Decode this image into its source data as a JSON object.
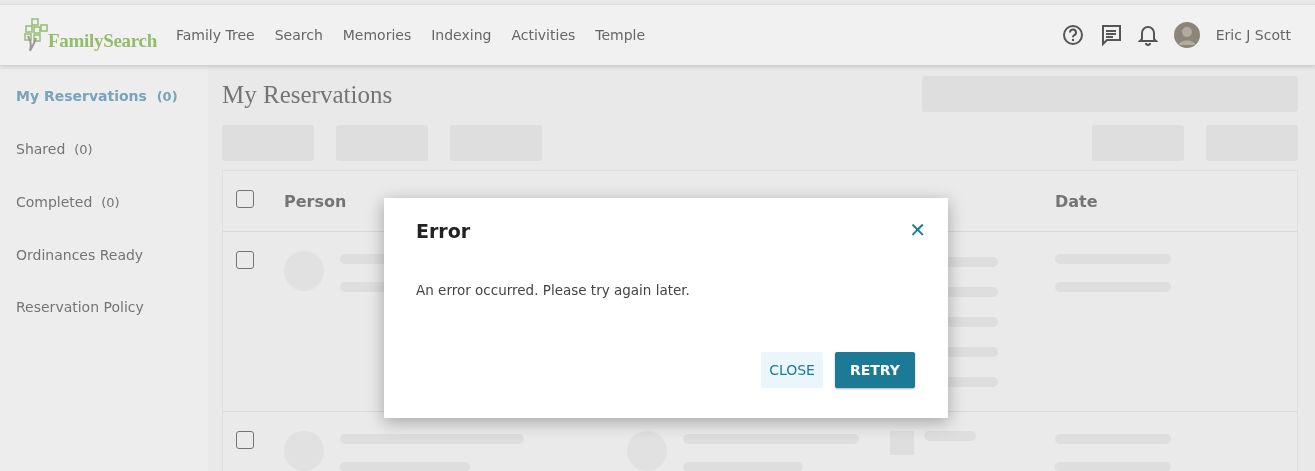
{
  "header": {
    "logo_text": "FamilySearch",
    "nav": [
      {
        "label": "Family Tree"
      },
      {
        "label": "Search"
      },
      {
        "label": "Memories"
      },
      {
        "label": "Indexing"
      },
      {
        "label": "Activities"
      },
      {
        "label": "Temple"
      }
    ],
    "user_name": "Eric J Scott"
  },
  "sidebar": {
    "items": [
      {
        "label": "My Reservations",
        "count": "(0)",
        "selected": true
      },
      {
        "label": "Shared",
        "count": "(0)",
        "selected": false
      },
      {
        "label": "Completed",
        "count": "(0)",
        "selected": false
      },
      {
        "label": "Ordinances Ready",
        "selected": false
      },
      {
        "label": "Reservation Policy",
        "selected": false
      }
    ]
  },
  "page_title": "My Reservations",
  "table": {
    "select_all_checked": false,
    "columns": [
      "Person",
      "Date"
    ],
    "rows": [
      {
        "checked": false
      },
      {
        "checked": false
      }
    ]
  },
  "dialog": {
    "title": "Error",
    "message": "An error occurred. Please try again later.",
    "close_icon": "✕",
    "buttons": [
      {
        "label": "CLOSE",
        "kind": "secondary"
      },
      {
        "label": "RETRY",
        "kind": "primary"
      }
    ]
  }
}
